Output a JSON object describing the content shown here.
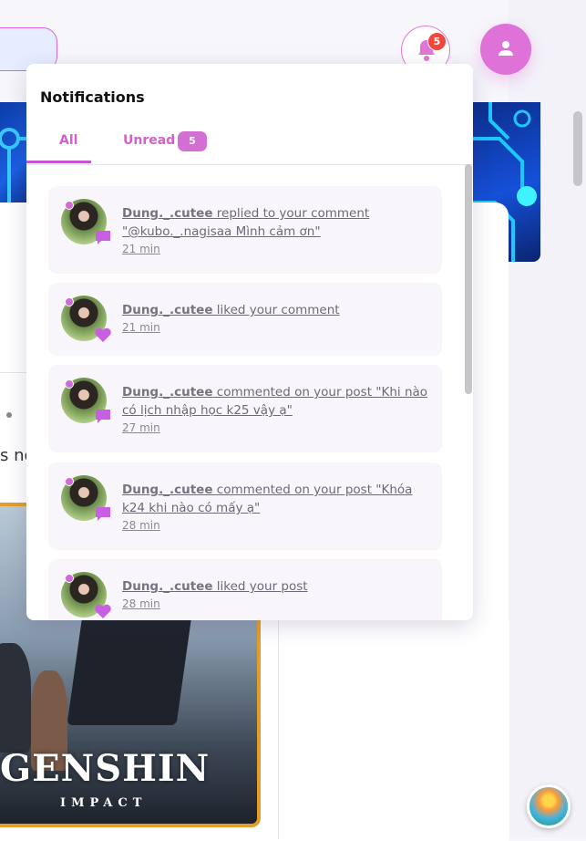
{
  "header": {
    "notification_count": "5"
  },
  "background": {
    "text_fragment": "s no",
    "post_image_logo": "GENSHIN",
    "post_image_logo_sub": "IMPACT"
  },
  "notifications": {
    "title": "Notifications",
    "tabs": [
      {
        "label": "All",
        "active": true
      },
      {
        "label": "Unread",
        "active": false
      }
    ],
    "unread_count": "5",
    "items": [
      {
        "user": "Dung._.cutee",
        "action": " replied to your comment",
        "detail": "\"@kubo._.nagisaa Mình cảm ơn\"",
        "time": "21 min",
        "type_icon": "comment-icon"
      },
      {
        "user": "Dung._.cutee",
        "action": " liked your comment",
        "detail": "",
        "time": "21 min",
        "type_icon": "heart-icon"
      },
      {
        "user": "Dung._.cutee",
        "action": " commented on your post \"Khi nào",
        "detail": "có lịch nhập học k25 vậy ạ\"",
        "time": "27 min",
        "type_icon": "comment-icon"
      },
      {
        "user": "Dung._.cutee",
        "action": " commented on your post \"Khóa",
        "detail": "k24 khi nào có mấy ạ\"",
        "time": "28 min",
        "type_icon": "comment-icon"
      },
      {
        "user": "Dung._.cutee",
        "action": " liked your post",
        "detail": "",
        "time": "28 min",
        "type_icon": "heart-icon"
      }
    ]
  },
  "colors": {
    "accent": "#d45fd0",
    "badge_red": "#f0473e",
    "item_bg": "#f8f6fa"
  }
}
